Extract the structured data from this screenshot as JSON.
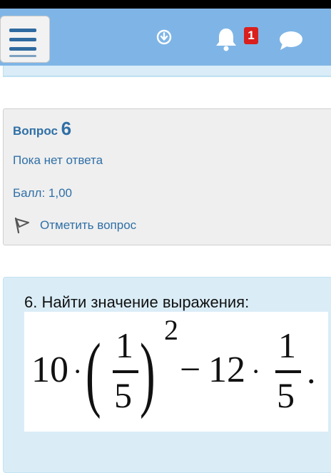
{
  "navbar": {
    "notification_count": "1",
    "menu_icon": "hamburger-icon",
    "icons": [
      "download-icon",
      "bell-icon",
      "chat-icon"
    ]
  },
  "question_info": {
    "label": "Вопрос",
    "number": "6",
    "state": "Пока нет ответа",
    "grade": "Балл: 1,00",
    "flag_label": "Отметить вопрос",
    "flag_icon": "flag-icon"
  },
  "question": {
    "text": "6. Найти значение выражения:",
    "formula": {
      "coef1": "10",
      "frac_num": "1",
      "frac_den": "5",
      "exponent": "2",
      "minus": "−",
      "coef2": "12",
      "frac2_num": "1",
      "frac2_den": "5",
      "end": "."
    }
  },
  "colors": {
    "navbar": "#7fb5e6",
    "link_blue": "#2f6fa6",
    "badge_red": "#d9201e",
    "content_bg": "#daedf7",
    "info_bg": "#efefef"
  }
}
